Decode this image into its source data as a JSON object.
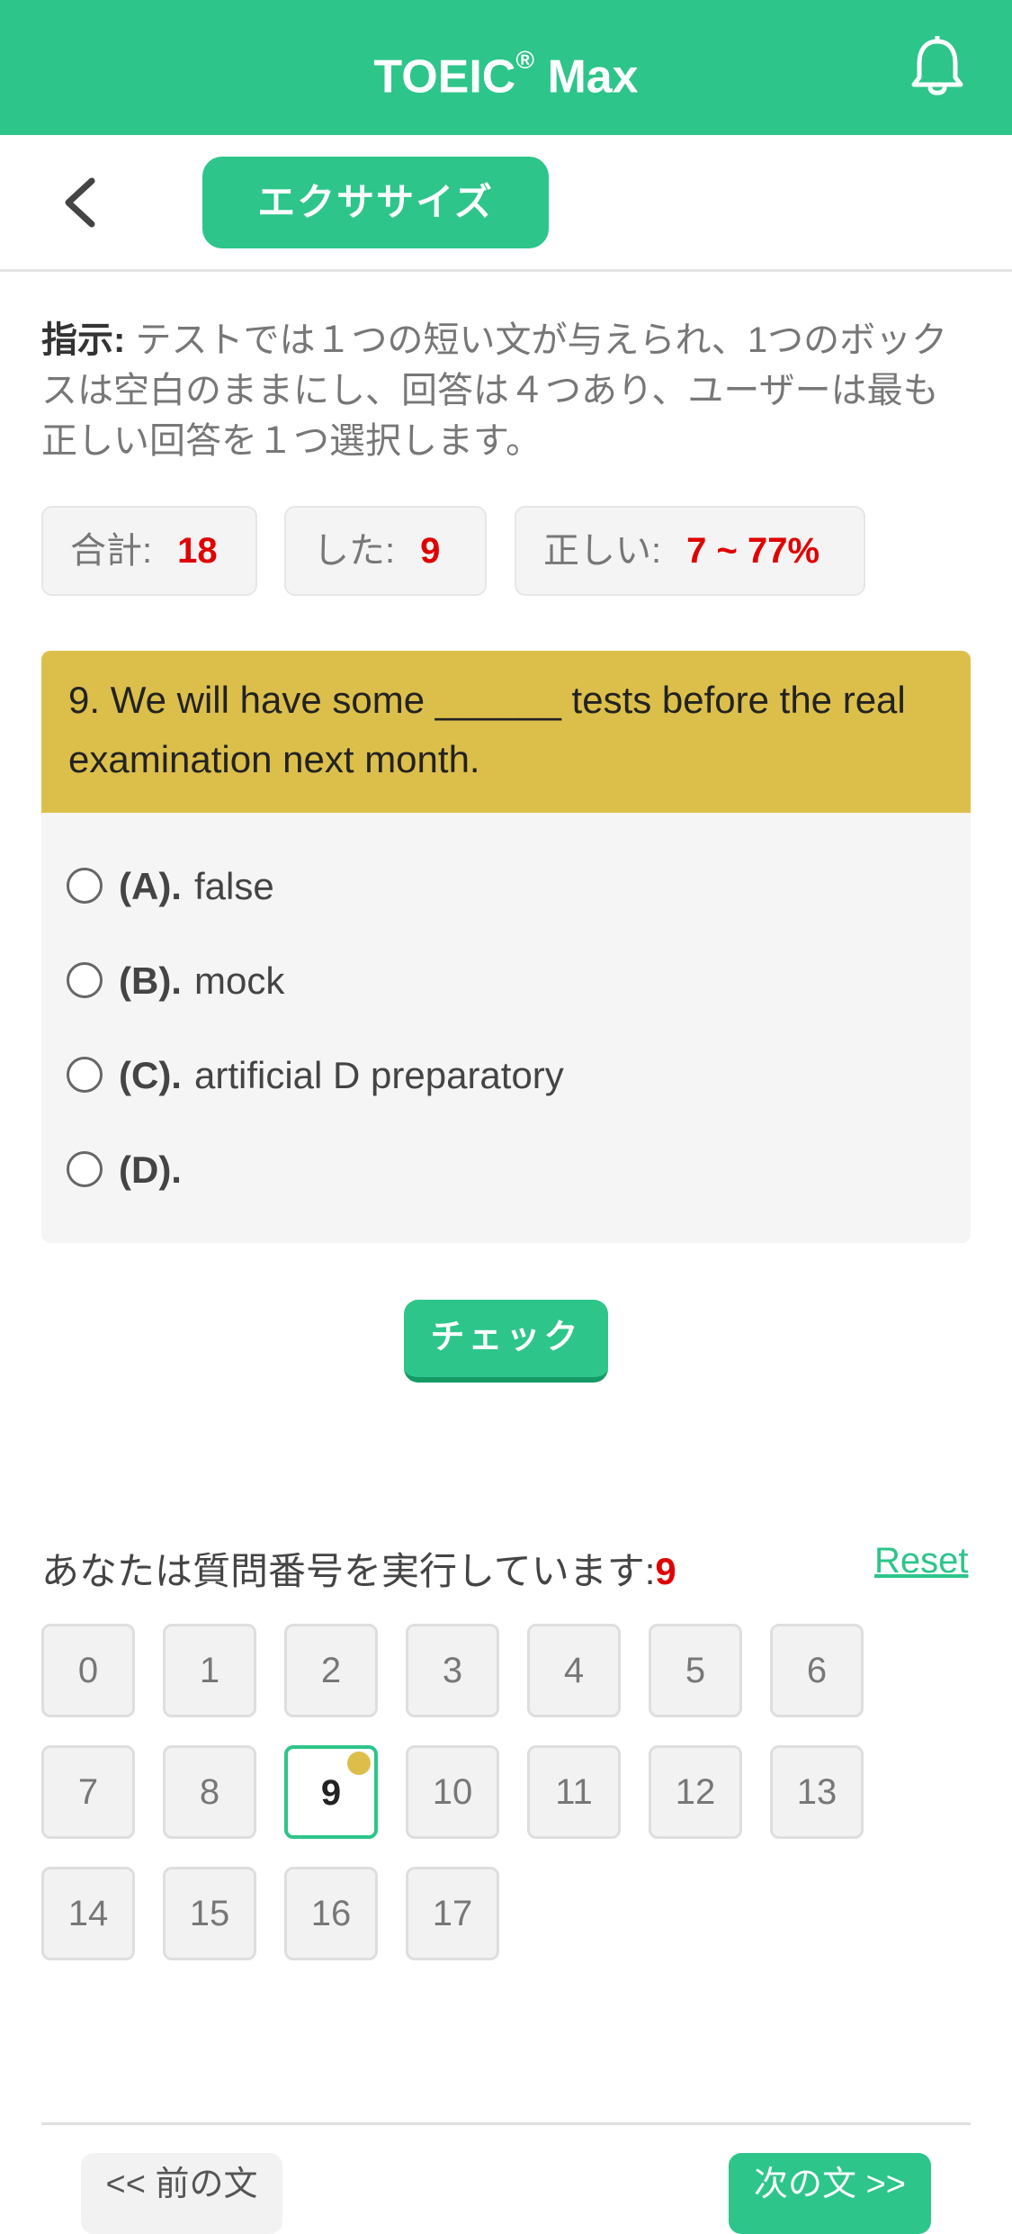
{
  "header": {
    "title": "TOEIC",
    "title_mark": "®",
    "title_suffix": " Max",
    "bell_icon": "bell-icon"
  },
  "subheader": {
    "back_icon": "chevron-left-icon",
    "tab_label": "エクササイズ"
  },
  "instructions": {
    "label": "指示:",
    "text": " テストでは１つの短い文が与えられ、1つのボックスは空白のままにし、回答は４つあり、ユーザーは最も正しい回答を１つ選択します。"
  },
  "stats": {
    "total_label": "合計:",
    "total_value": "18",
    "done_label": "した:",
    "done_value": "9",
    "correct_label": "正しい:",
    "correct_value": "7 ~ 77%"
  },
  "question": {
    "text": "9. We will have some ______ tests before the real examination next month.",
    "options": [
      {
        "label": "(A).",
        "text": "false"
      },
      {
        "label": "(B).",
        "text": "mock"
      },
      {
        "label": "(C).",
        "text": "artificial D preparatory"
      },
      {
        "label": "(D).",
        "text": ""
      }
    ]
  },
  "check_label": "チェック",
  "navigator": {
    "label": "あなたは質問番号を実行しています:",
    "current": "9",
    "reset_label": "Reset",
    "numbers": [
      "0",
      "1",
      "2",
      "3",
      "4",
      "5",
      "6",
      "7",
      "8",
      "9",
      "10",
      "11",
      "12",
      "13",
      "14",
      "15",
      "16",
      "17"
    ]
  },
  "footer": {
    "prev_label": "<< 前の文",
    "next_label": "次の文 >>"
  },
  "colors": {
    "brand": "#2dc58a",
    "question_bg": "#dcbf4b",
    "accent_red": "#e00000"
  }
}
